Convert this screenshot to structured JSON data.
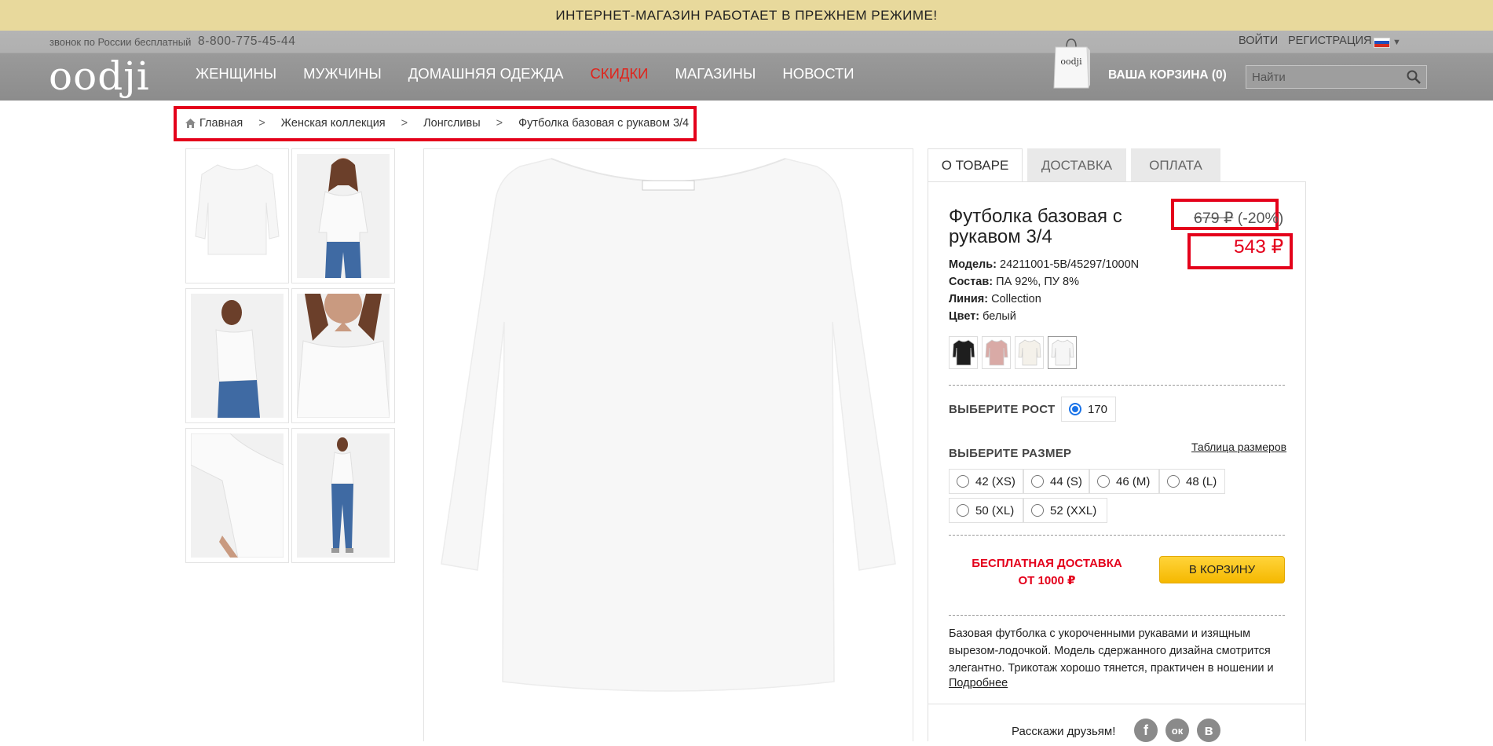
{
  "announcement": "ИНТЕРНЕТ-МАГАЗИН РАБОТАЕТ В ПРЕЖНЕМ РЕЖИМЕ!",
  "header": {
    "phone_label": "звонок по России бесплатный",
    "phone": "8-800-775-45-44",
    "login": "ВОЙТИ",
    "register": "РЕГИСТРАЦИЯ",
    "logo": "oodji",
    "bag_logo": "oodji",
    "nav": [
      "ЖЕНЩИНЫ",
      "МУЖЧИНЫ",
      "ДОМАШНЯЯ ОДЕЖДА",
      "СКИДКИ",
      "МАГАЗИНЫ",
      "НОВОСТИ"
    ],
    "cart": "ВАША КОРЗИНА (0)",
    "search_placeholder": "Найти"
  },
  "breadcrumb": [
    "Главная",
    "Женская коллекция",
    "Лонгсливы",
    "Футболка базовая с рукавом 3/4"
  ],
  "tabs": [
    "О ТОВАРЕ",
    "ДОСТАВКА",
    "ОПЛАТА"
  ],
  "product": {
    "title": "Футболка базовая с рукавом 3/4",
    "old_price": "679 ₽",
    "discount": "(-20%)",
    "new_price": "543 ₽",
    "attributes": [
      {
        "label": "Модель:",
        "value": "24211001-5B/45297/1000N"
      },
      {
        "label": "Состав:",
        "value": "ПА 92%, ПУ 8%"
      },
      {
        "label": "Линия:",
        "value": "Collection"
      },
      {
        "label": "Цвет:",
        "value": "белый"
      }
    ],
    "swatch_colors": [
      "#1e1e1e",
      "#d9aaa6",
      "#f4f1ea",
      "#f6f6f6"
    ],
    "height_label": "ВЫБЕРИТЕ РОСТ",
    "height_option": "170",
    "size_label": "ВЫБЕРИТЕ РАЗМЕР",
    "size_table": "Таблица размеров",
    "sizes": [
      "42 (XS)",
      "44 (S)",
      "46 (M)",
      "48 (L)",
      "50 (XL)",
      "52 (XXL)"
    ],
    "free_shipping_1": "БЕСПЛАТНАЯ ДОСТАВКА",
    "free_shipping_2": "ОТ 1000 ₽",
    "add_to_cart": "В КОРЗИНУ",
    "description": "Базовая футболка с укороченными рукавами и изящным вырезом-лодочкой. Модель сдержанного дизайна смотрится элегантно. Трикотаж хорошо тянется, практичен в ношении и",
    "more": "Подробнее",
    "share": "Расскажи друзьям!",
    "social": [
      "f",
      "ок",
      "в"
    ]
  },
  "colors": {
    "accent_red": "#e4001b",
    "banner": "#e8d99c",
    "button_yellow": "#ffd43a"
  }
}
